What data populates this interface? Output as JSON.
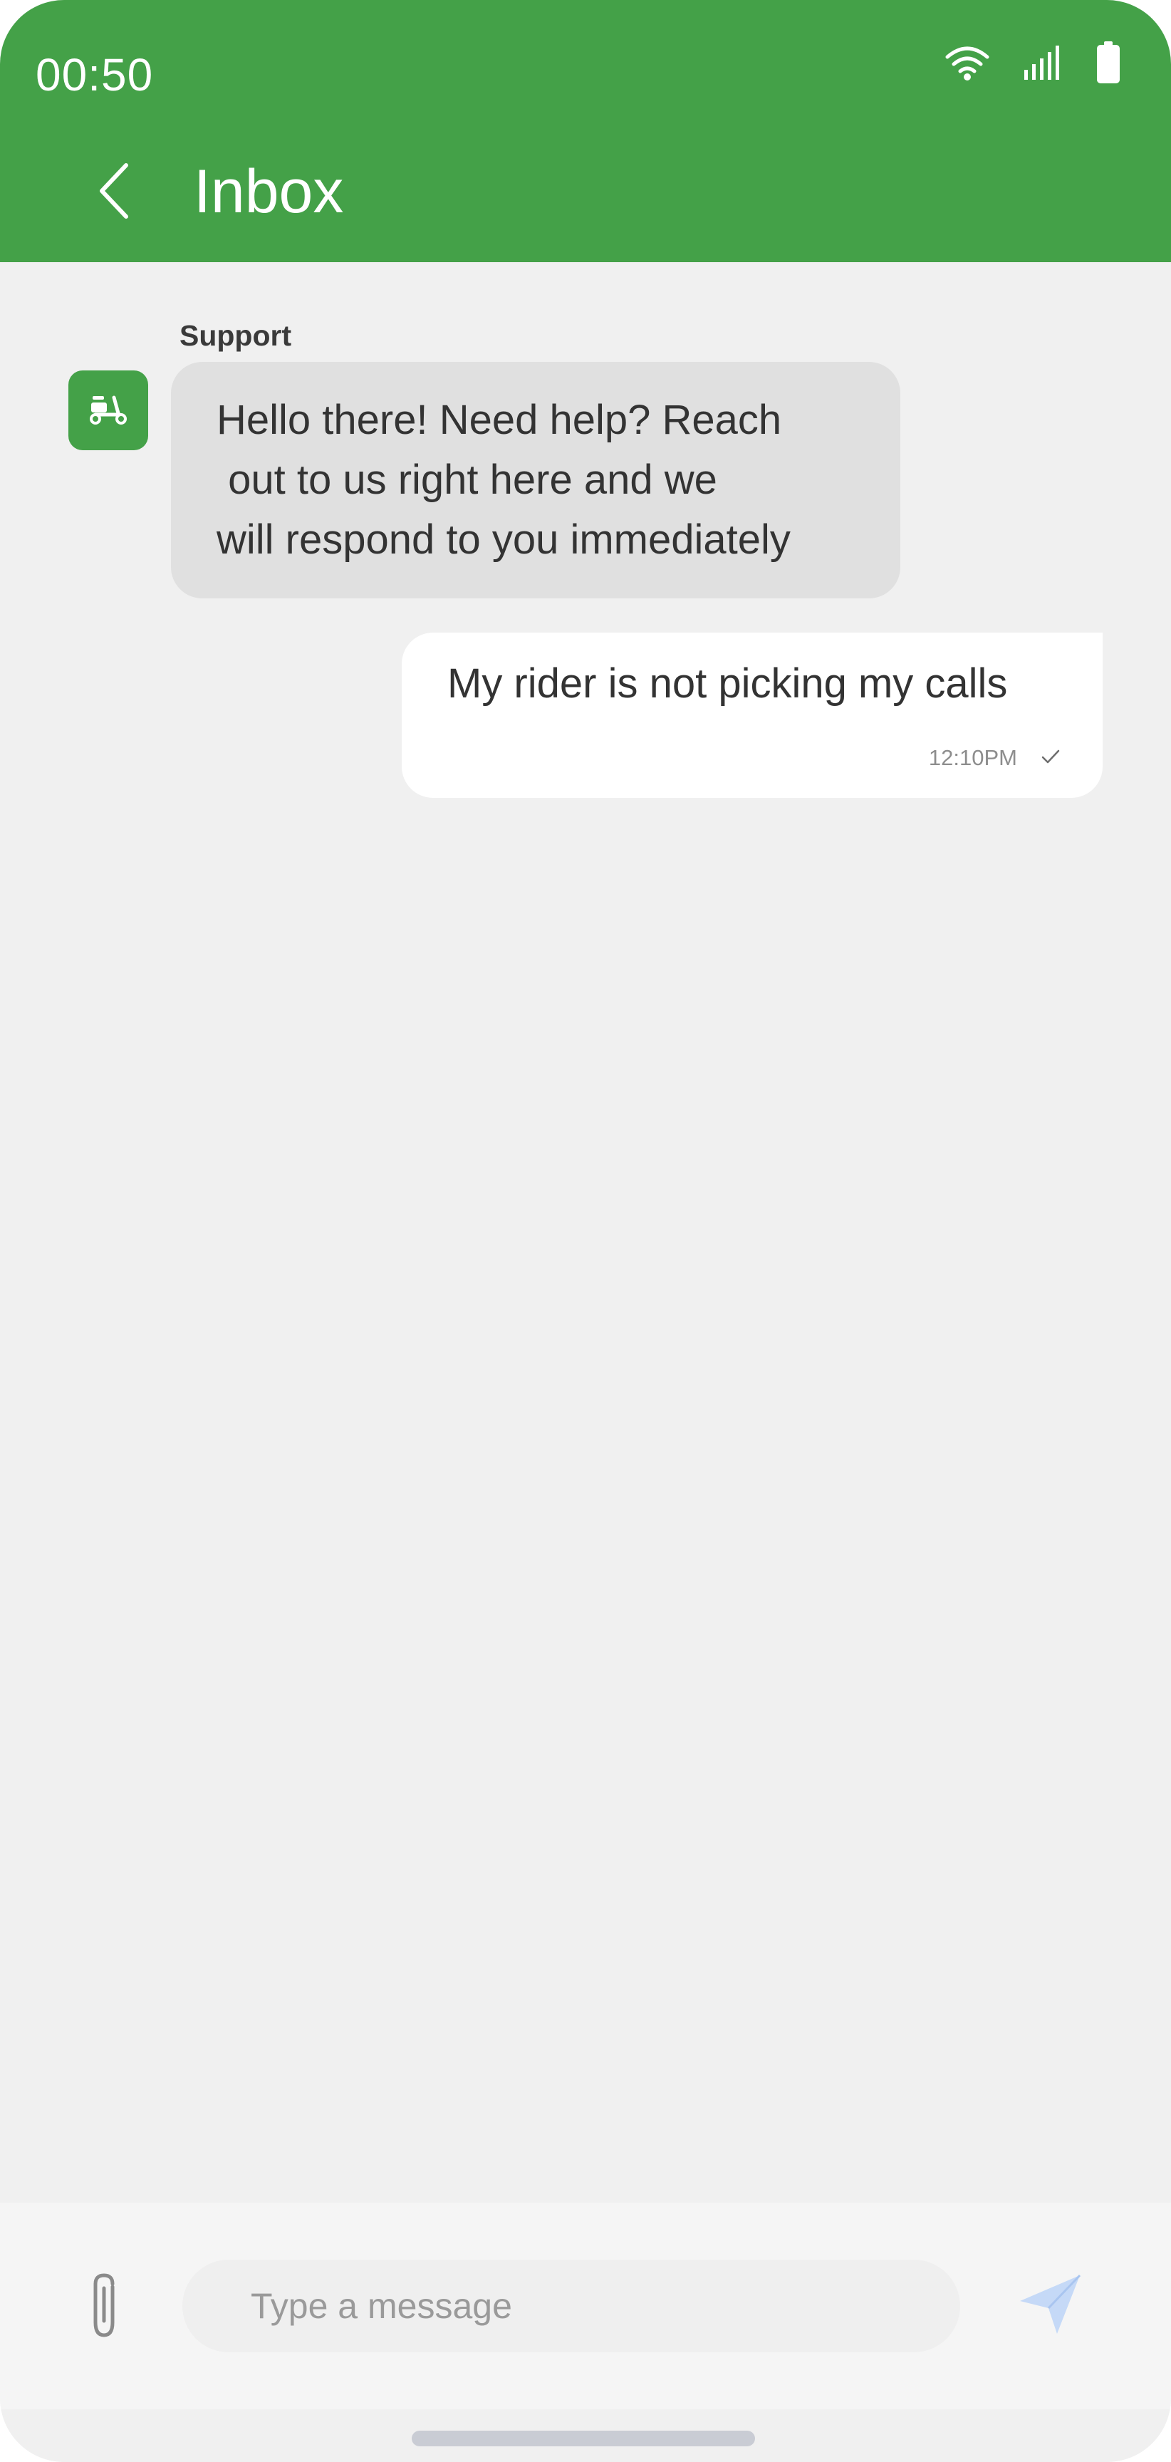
{
  "status_bar": {
    "time": "00:50",
    "icons": [
      "wifi-icon",
      "signal-icon",
      "battery-icon"
    ]
  },
  "header": {
    "back_icon": "chevron-left-icon",
    "title": "Inbox"
  },
  "conversation": {
    "support": {
      "sender": "Support",
      "avatar_icon": "scooter-icon",
      "text": "Hello there! Need help? Reach\n out to us right here and we\nwill respond to you immediately"
    },
    "user_message": {
      "text": "My rider is not picking my calls",
      "time": "12:10PM",
      "status_icon": "check-icon"
    }
  },
  "composer": {
    "attach_icon": "paperclip-icon",
    "placeholder": "Type a message",
    "value": "",
    "send_icon": "send-icon"
  },
  "colors": {
    "brand_green": "#44a148",
    "background": "#f0f0f0",
    "incoming_bubble": "#e0e0e0",
    "outgoing_bubble": "#ffffff",
    "send_icon": "#c5d9f7"
  }
}
